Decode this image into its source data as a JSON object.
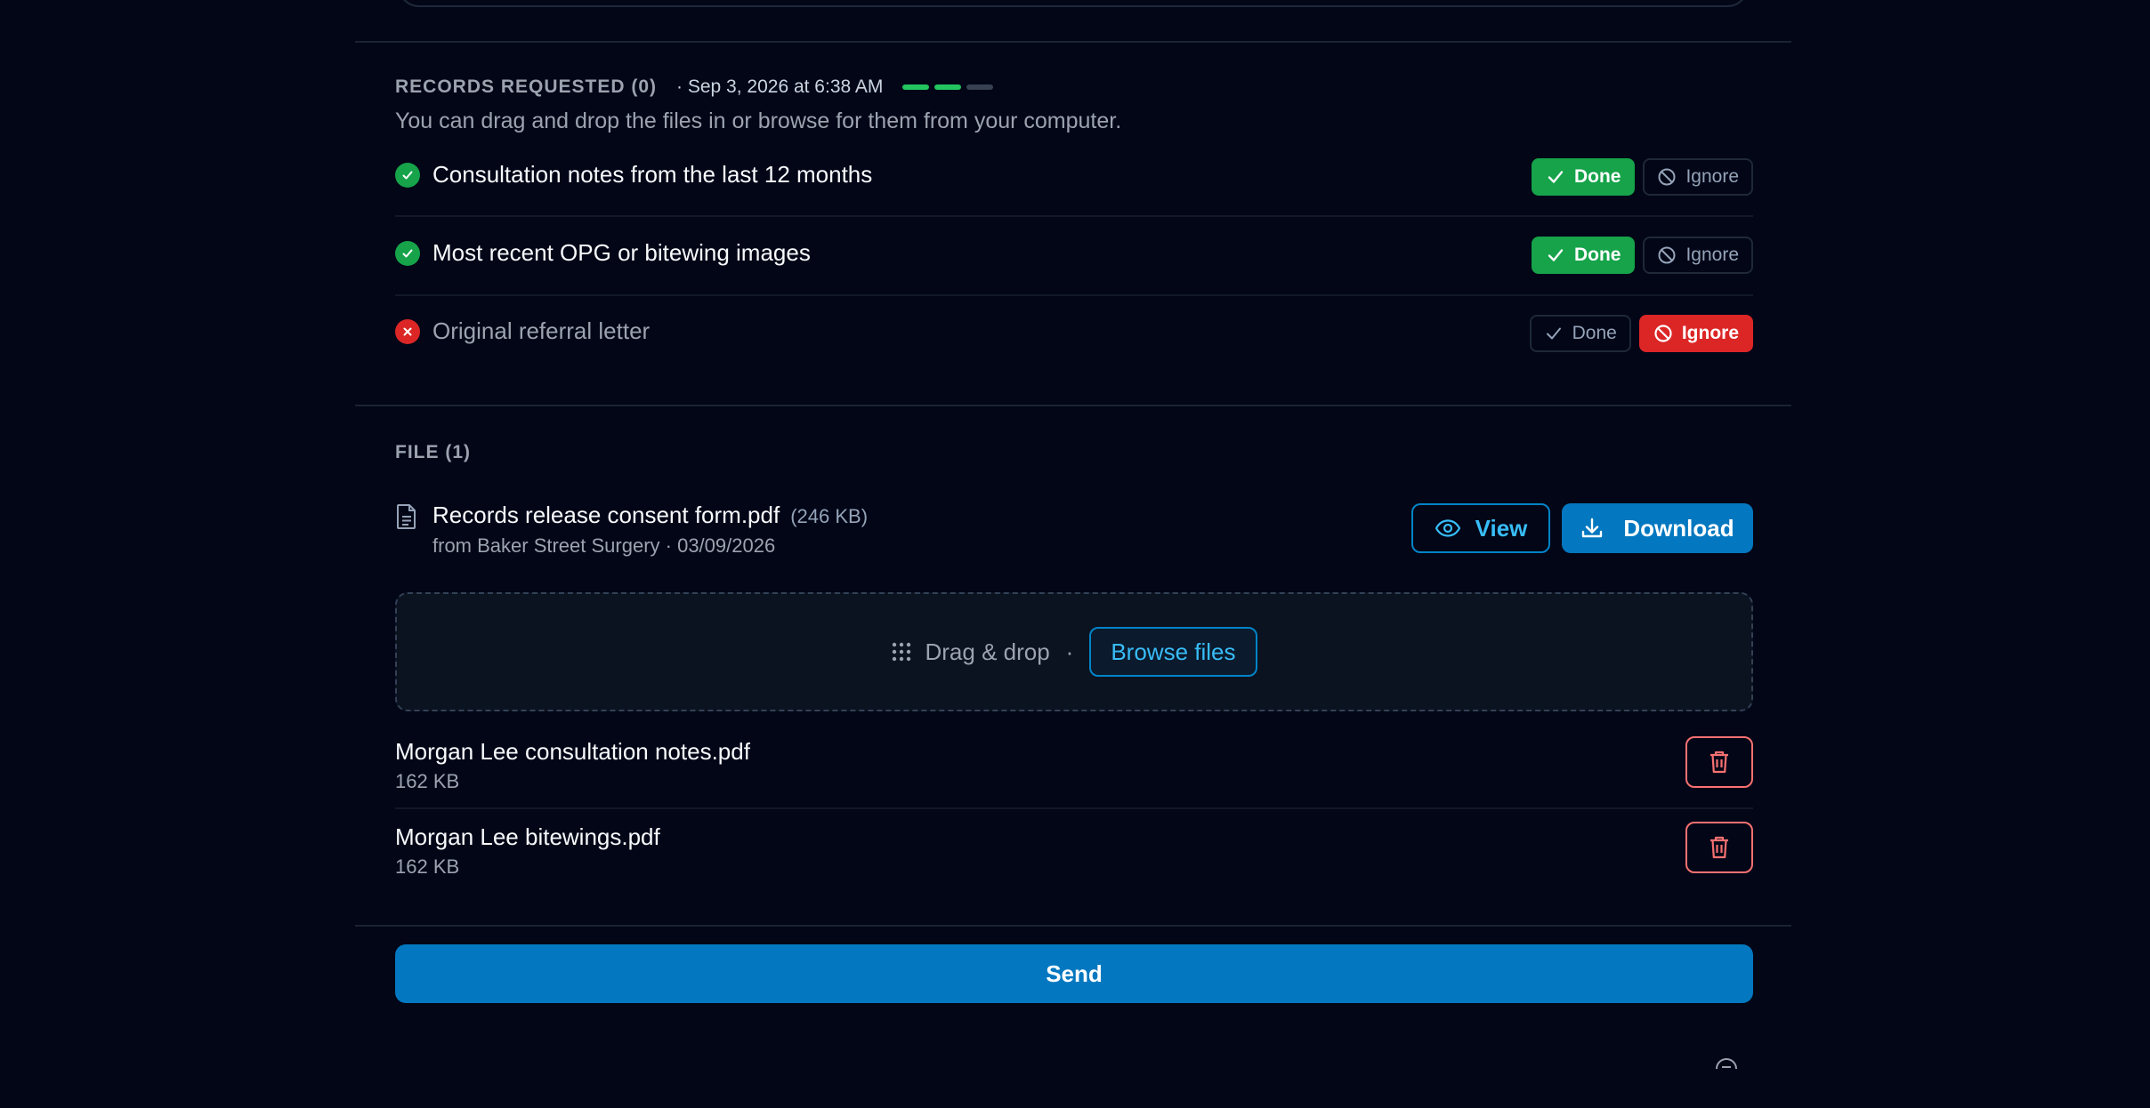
{
  "records": {
    "title": "RECORDS REQUESTED (0)",
    "date": "· Sep 3, 2026 at 6:38 AM",
    "progress": [
      true,
      true,
      false
    ],
    "hint": "You can drag and drop the files in or browse for them from your computer.",
    "items": [
      {
        "label": "Consultation notes from the last 12 months",
        "status": "done",
        "done_label": "Done",
        "ignore_label": "Ignore"
      },
      {
        "label": "Most recent OPG or bitewing images",
        "status": "done",
        "done_label": "Done",
        "ignore_label": "Ignore"
      },
      {
        "label": "Original referral letter",
        "status": "ignored",
        "done_label": "Done",
        "ignore_label": "Ignore"
      }
    ]
  },
  "file": {
    "title": "FILE (1)",
    "name": "Records release consent form.pdf",
    "size": "(246 KB)",
    "meta": "from Baker Street Surgery · 03/09/2026",
    "view_label": "View",
    "download_label": "Download"
  },
  "dropzone": {
    "text": "Drag & drop",
    "separator": "·",
    "browse_label": "Browse files"
  },
  "uploads": [
    {
      "name": "Morgan Lee consultation notes.pdf",
      "size": "162 KB"
    },
    {
      "name": "Morgan Lee bitewings.pdf",
      "size": "162 KB"
    }
  ],
  "send_label": "Send",
  "colors": {
    "accent": "#0378c0",
    "success": "#16a34a",
    "danger": "#dc2626"
  }
}
